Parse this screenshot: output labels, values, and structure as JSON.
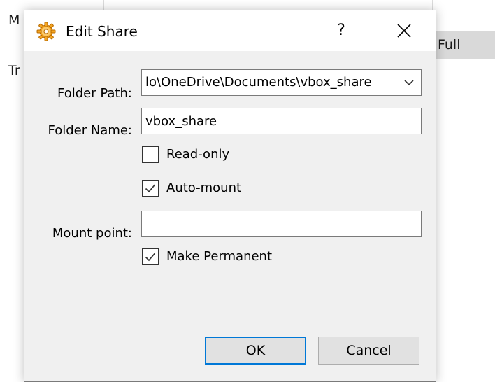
{
  "background": {
    "label_m": "M",
    "label_tr": "Tr",
    "cell_full": "Full"
  },
  "dialog": {
    "title": "Edit Share",
    "help_label": "?",
    "icons": {
      "app": "virtualbox-gear-icon",
      "close": "close-icon",
      "dropdown": "chevron-down-icon",
      "check": "check-icon"
    },
    "folder_path": {
      "label": "Folder Path:",
      "value": "lo\\OneDrive\\Documents\\vbox_share"
    },
    "folder_name": {
      "label": "Folder Name:",
      "value": "vbox_share"
    },
    "read_only": {
      "label": "Read-only",
      "checked": false
    },
    "auto_mount": {
      "label": "Auto-mount",
      "checked": true
    },
    "mount_point": {
      "label": "Mount point:",
      "value": ""
    },
    "make_permanent": {
      "label": "Make Permanent",
      "checked": true
    },
    "buttons": {
      "ok": "OK",
      "cancel": "Cancel"
    },
    "colors": {
      "accent": "#0078d7",
      "icon_orange": "#f5a623"
    }
  }
}
